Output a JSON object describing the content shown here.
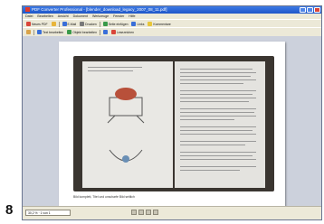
{
  "figure_label": "8",
  "window": {
    "title": "PDF Converter Professional - [blender_download_legacy_2007_08_11.pdf]"
  },
  "menu": [
    "Datei",
    "Bearbeiten",
    "Ansicht",
    "Dokument",
    "Werkzeuge",
    "Fenster",
    "Hilfe"
  ],
  "toolbar1": [
    {
      "label": "Neues PDF",
      "icon": "new-pdf-icon",
      "color": "#d9463a"
    },
    {
      "label": "",
      "icon": "open-icon",
      "color": "#e8b53a"
    },
    {
      "label": "E-Mail",
      "icon": "mail-icon",
      "color": "#3a6fd9"
    },
    {
      "label": "Drucken",
      "icon": "print-icon",
      "color": "#7a7a7a"
    },
    {
      "label": "Seite einfügen",
      "icon": "insert-page-icon",
      "color": "#3a9a4a"
    },
    {
      "label": "Links",
      "icon": "link-icon",
      "color": "#3a6fd9"
    },
    {
      "label": "Kommentare",
      "icon": "comment-icon",
      "color": "#e8c63a"
    }
  ],
  "toolbar2": [
    {
      "label": "",
      "icon": "hand-icon",
      "color": "#d9a34a"
    },
    {
      "label": "Text bearbeiten",
      "icon": "edit-text-icon",
      "color": "#3a6fd9"
    },
    {
      "label": "Objekt bearbeiten",
      "icon": "edit-object-icon",
      "color": "#3a9a4a"
    },
    {
      "label": "",
      "icon": "zoom-icon",
      "color": "#3a6fd9"
    },
    {
      "label": "Lesezeichen",
      "icon": "bookmark-icon",
      "color": "#d9463a"
    }
  ],
  "document": {
    "caption": "Bild komplett, Titel und unscharfe Bild seitlich"
  },
  "status": {
    "zoom": "30,2 %  ·  1 von 1"
  }
}
